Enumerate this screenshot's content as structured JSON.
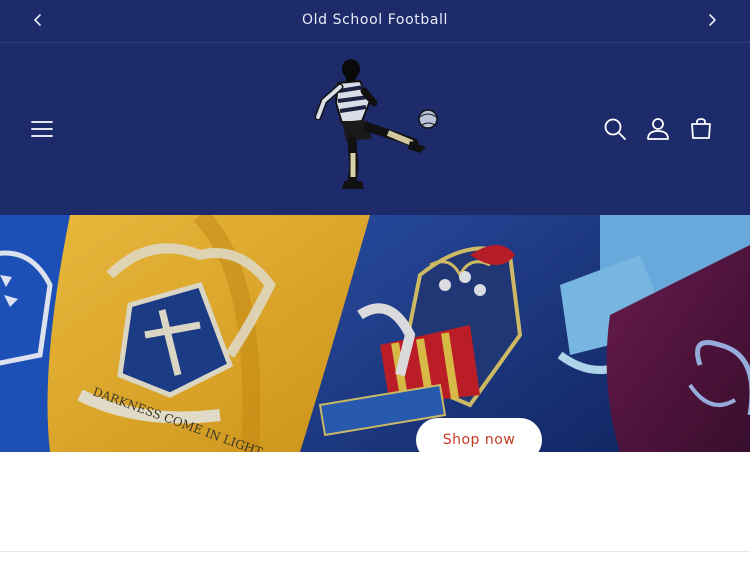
{
  "announcement": {
    "text": "Old School Football"
  },
  "header": {
    "icons": [
      "menu-icon",
      "search-icon",
      "account-icon",
      "cart-icon"
    ]
  },
  "hero": {
    "cta_label": "Shop now",
    "crest_text": "DARKNESS COME IN LIGHT"
  },
  "colors": {
    "brand": "#1d2b6b",
    "cta_text": "#c23a22"
  }
}
